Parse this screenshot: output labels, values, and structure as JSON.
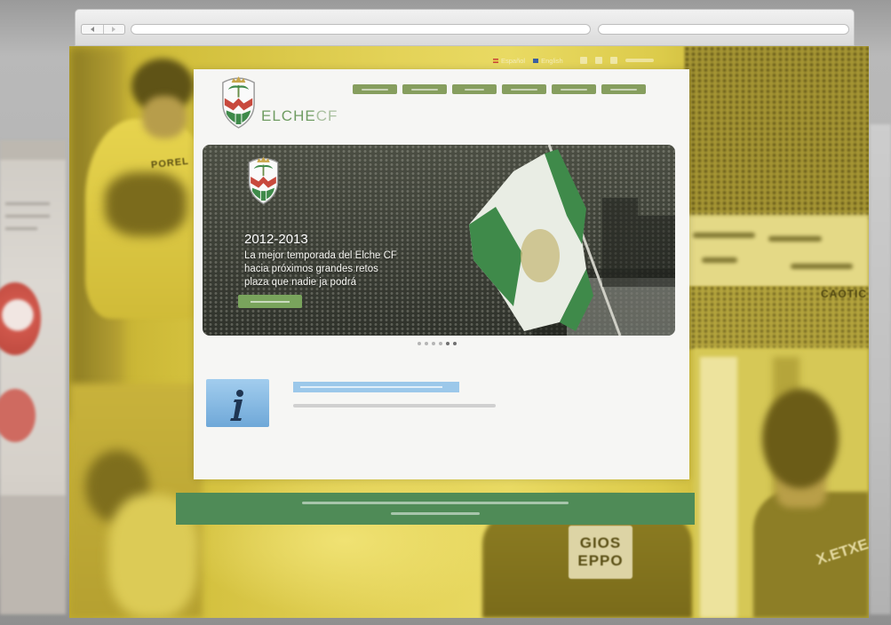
{
  "colors": {
    "page_yellow": "#d8c53e",
    "panel_bg": "#f6f6f4",
    "nav_green": "#869e5e",
    "logo_green": "#6f9c62",
    "cta_green": "#79a45c",
    "footer_green": "#4f8b57",
    "info_blue": "#9cc8ea",
    "hero_dark": "#3c3f36"
  },
  "top_links": {
    "languages": [
      "Español",
      "English"
    ]
  },
  "logo": {
    "main": "ELCHE",
    "sub": "CF"
  },
  "slider": {
    "year": "2012-2013",
    "lines": [
      "La mejor temporada del Elche CF",
      "hacia próximos grandes retos",
      "plaza que nadie ja podrá"
    ]
  },
  "background": {
    "jersey_left": "POREL",
    "banner": "CAOTIC",
    "sponsor": [
      "GIOS",
      "EPPO"
    ],
    "jersey_right": "X.ETXE"
  }
}
